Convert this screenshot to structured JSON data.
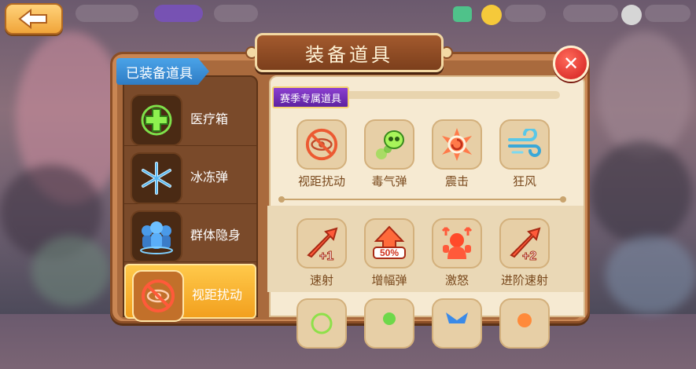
{
  "title": "装备道具",
  "close_glyph": "✕",
  "equipped": {
    "tab_label": "已装备道具",
    "items": [
      {
        "label": "医疗箱",
        "icon": "medkit-icon"
      },
      {
        "label": "冰冻弹",
        "icon": "snowflake-icon"
      },
      {
        "label": "群体隐身",
        "icon": "group-stealth-icon"
      },
      {
        "label": "视距扰动",
        "icon": "vision-disrupt-icon",
        "selected": true
      }
    ]
  },
  "section": {
    "header": "赛季专属道具",
    "row1": [
      {
        "label": "视距扰动",
        "icon": "vision-disrupt-icon"
      },
      {
        "label": "毒气弹",
        "icon": "poison-skull-icon"
      },
      {
        "label": "震击",
        "icon": "shock-icon"
      },
      {
        "label": "狂风",
        "icon": "wind-icon"
      }
    ],
    "row2": [
      {
        "label": "速射",
        "icon": "rapid-fire-icon",
        "badge": "+1"
      },
      {
        "label": "增幅弹",
        "icon": "amplify-icon",
        "badge": "50%"
      },
      {
        "label": "激怒",
        "icon": "rage-icon"
      },
      {
        "label": "进阶速射",
        "icon": "advanced-rapid-fire-icon",
        "badge": "+2"
      }
    ]
  },
  "colors": {
    "panel": "#c98653",
    "tab_blue": "#2f7cc4",
    "section_purple": "#6b2bb0",
    "label_brown": "#7a4a1e",
    "close_red": "#d11e1e"
  }
}
